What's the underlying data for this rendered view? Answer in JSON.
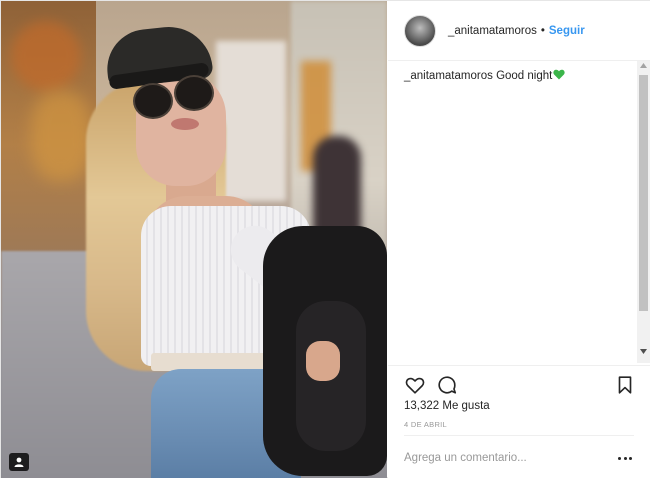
{
  "post": {
    "author": {
      "username": "_anitamatamoros",
      "separator": "•",
      "follow_label": "Seguir"
    },
    "caption": {
      "username": "_anitamatamoros",
      "text": "Good night",
      "emoji": "green-heart-icon",
      "emoji_color": "#3bb54a"
    },
    "likes_text": "13,322 Me gusta",
    "date_text": "4 DE ABRIL",
    "comment_placeholder": "Agrega un comentario...",
    "icons": {
      "like": "heart-outline-icon",
      "comment": "comment-bubble-icon",
      "save": "bookmark-icon",
      "more": "more-options-icon",
      "user_tag": "user-tag-icon"
    },
    "colors": {
      "link": "#3897f0",
      "text": "#262626",
      "muted": "#999999",
      "border": "#efefef"
    }
  }
}
